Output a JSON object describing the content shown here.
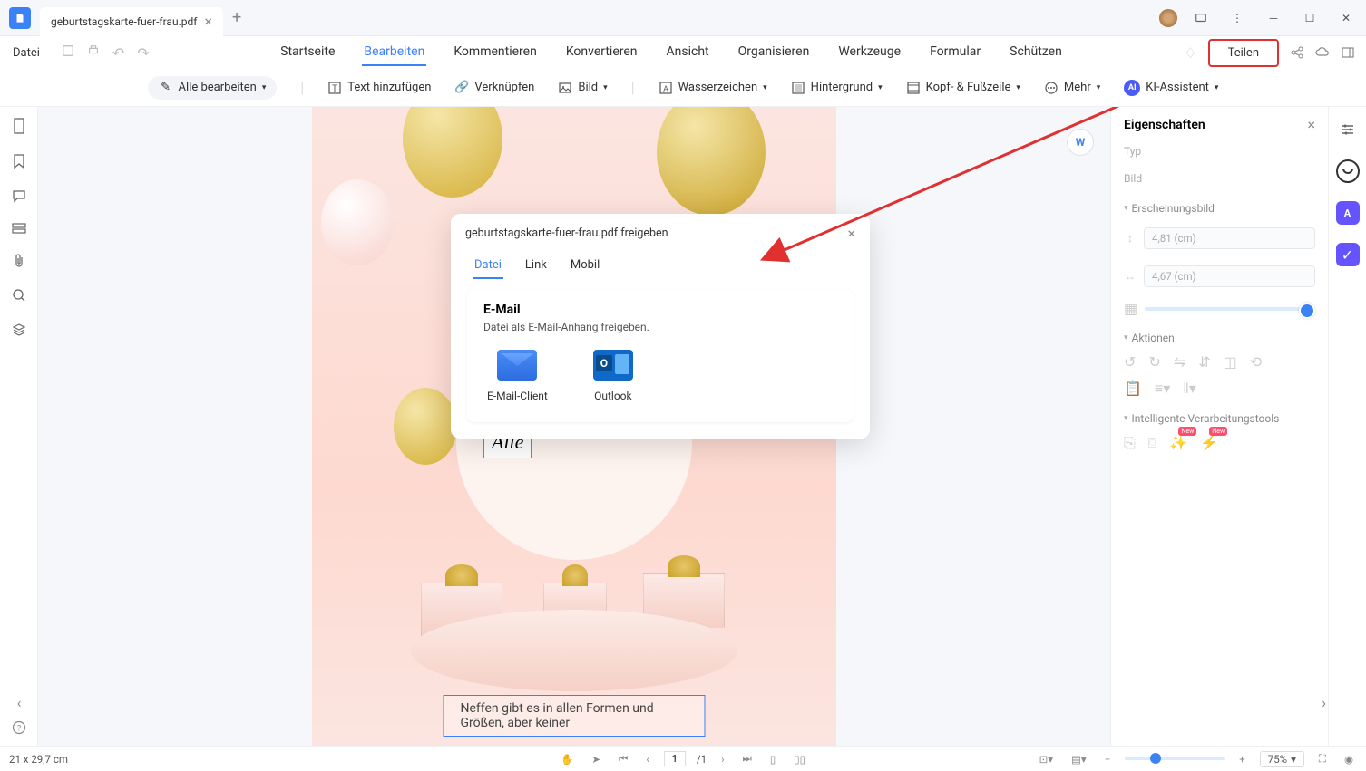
{
  "titlebar": {
    "tab_name": "geburtstagskarte-fuer-frau.pdf"
  },
  "menu": {
    "file": "Datei",
    "items": [
      "Startseite",
      "Bearbeiten",
      "Kommentieren",
      "Konvertieren",
      "Ansicht",
      "Organisieren",
      "Werkzeuge",
      "Formular",
      "Schützen"
    ],
    "active_index": 1,
    "share": "Teilen"
  },
  "toolbar": {
    "edit_all": "Alle bearbeiten",
    "add_text": "Text hinzufügen",
    "link": "Verknüpfen",
    "image": "Bild",
    "watermark": "Wasserzeichen",
    "background": "Hintergrund",
    "header_footer": "Kopf- & Fußzeile",
    "more": "Mehr",
    "ai_assist": "KI-Assistent"
  },
  "document": {
    "alle_text": "Alle",
    "caption": "Neffen gibt es in allen Formen und Größen, aber keiner",
    "float_badge": "W"
  },
  "dialog": {
    "title": "geburtstagskarte-fuer-frau.pdf freigeben",
    "tabs": [
      "Datei",
      "Link",
      "Mobil"
    ],
    "active_tab": 0,
    "section_title": "E-Mail",
    "section_desc": "Datei als E-Mail-Anhang freigeben.",
    "options": [
      "E-Mail-Client",
      "Outlook"
    ]
  },
  "properties": {
    "title": "Eigenschaften",
    "type_label": "Typ",
    "image_label": "Bild",
    "appearance": "Erscheinungsbild",
    "height": "4,81 (cm)",
    "width": "4,67 (cm)",
    "actions": "Aktionen",
    "smart": "Intelligente Verarbeitungstools"
  },
  "status": {
    "page_size": "21 x 29,7 cm",
    "current_page": "1",
    "total_pages": "1",
    "zoom": "75%"
  }
}
